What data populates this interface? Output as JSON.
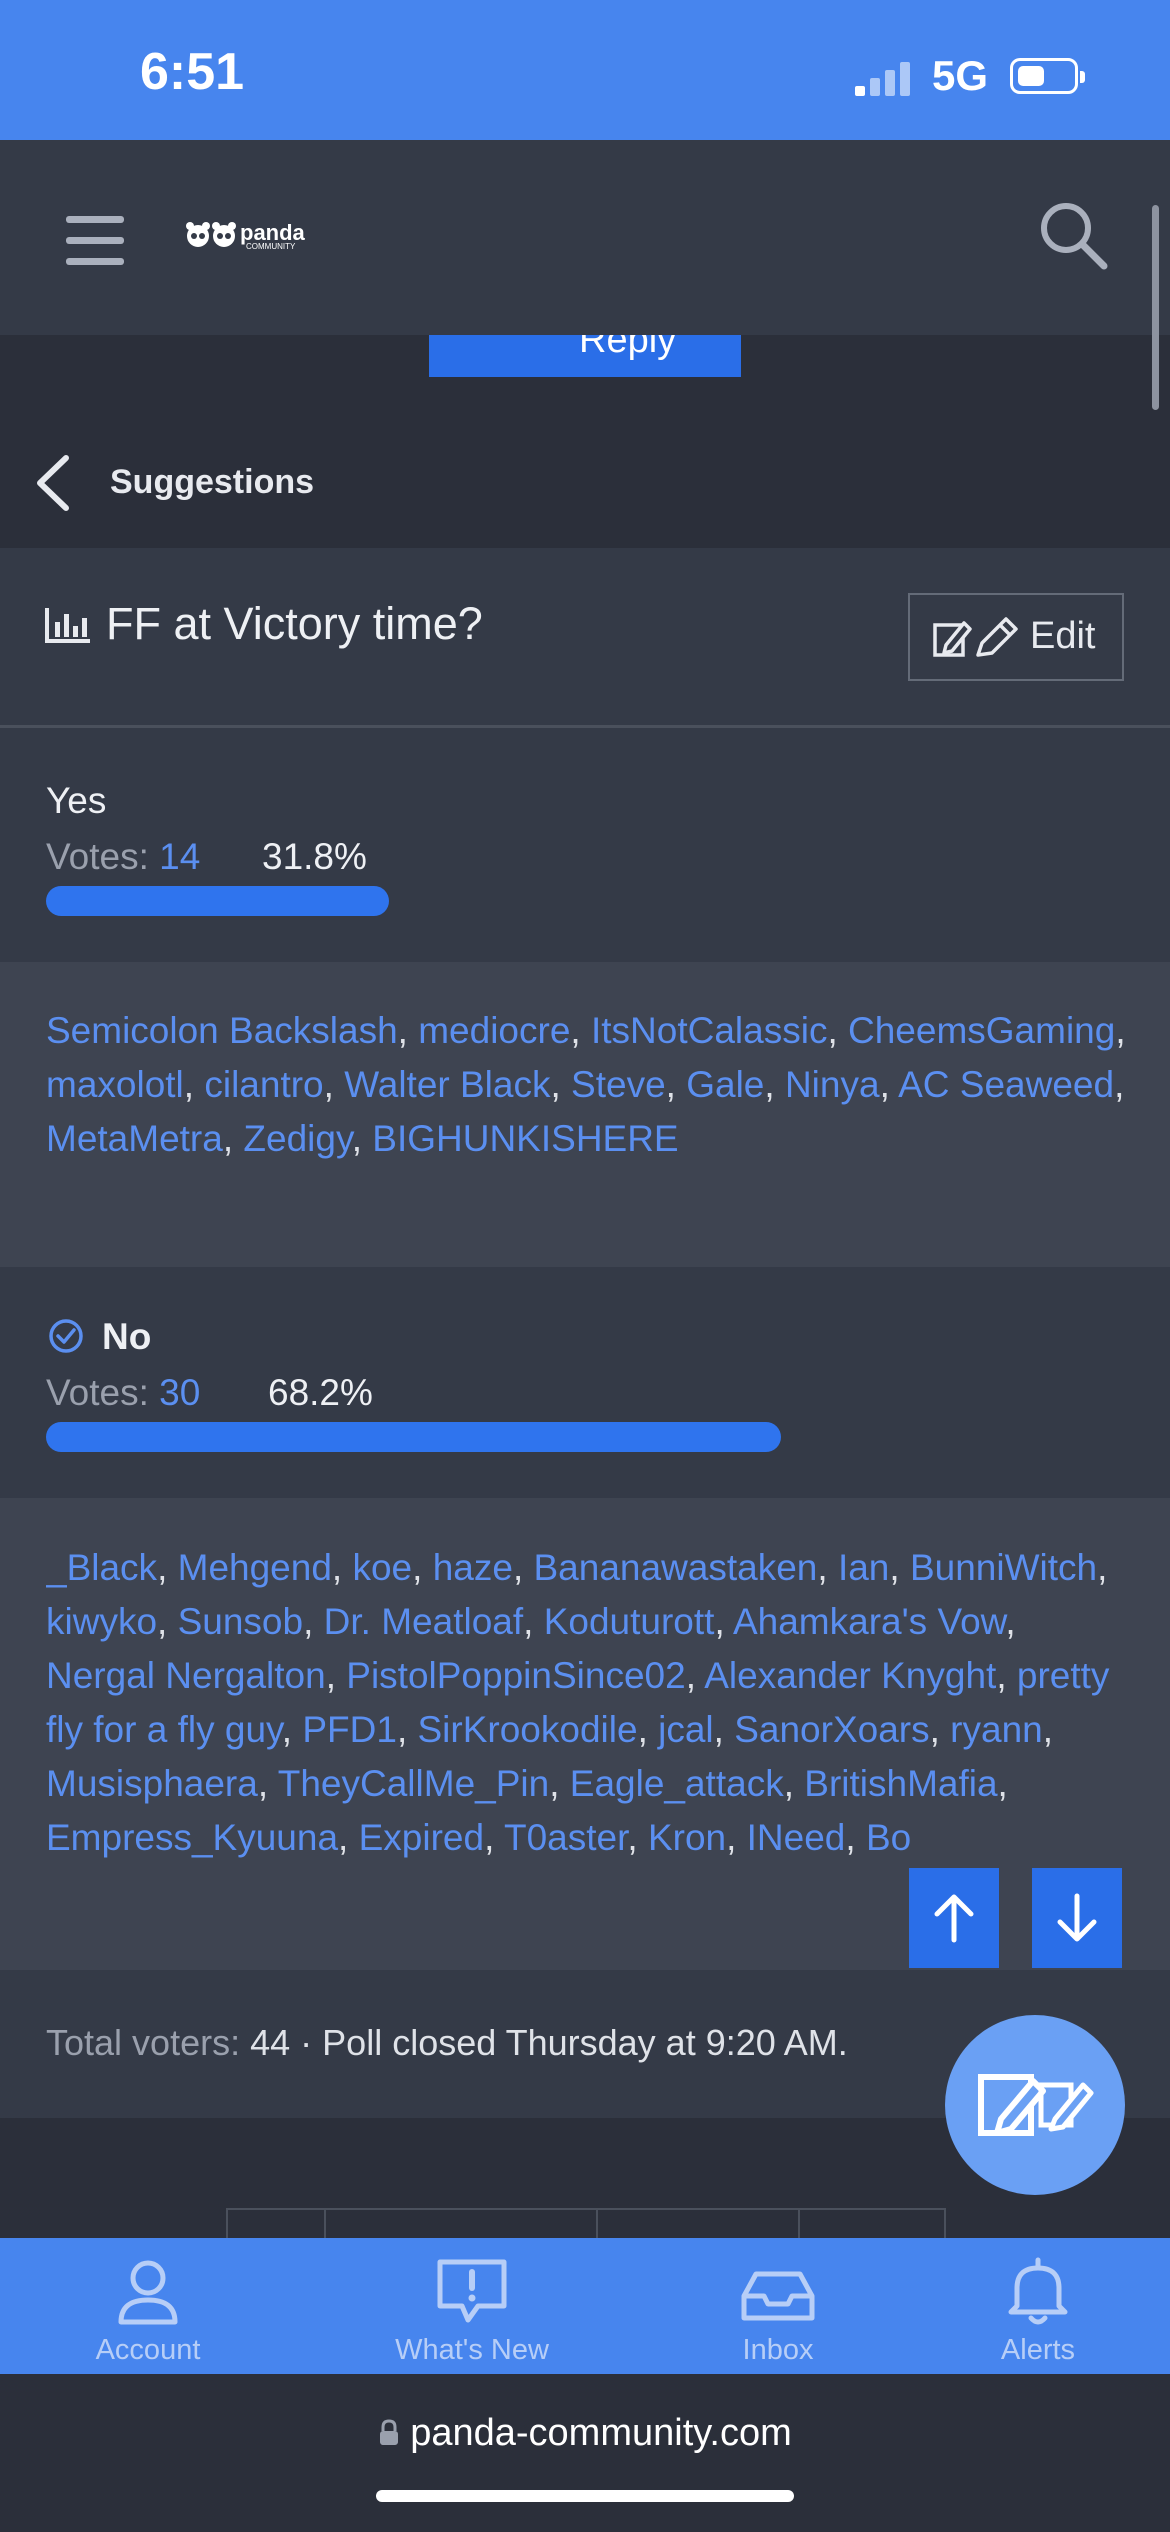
{
  "status_bar": {
    "time": "6:51",
    "network": "5G"
  },
  "header": {
    "logo_text": "panda",
    "logo_sub": "COMMUNITY"
  },
  "reply_button": {
    "label": "Reply"
  },
  "breadcrumb": {
    "label": "Suggestions"
  },
  "poll": {
    "title": "FF at Victory time?",
    "edit_label": "Edit",
    "votes_label": "Votes:",
    "responses": [
      {
        "label": "Yes",
        "votes": "14",
        "percent": "31.8%",
        "fraction": 0.318,
        "voters": [
          "Semicolon Backslash",
          "mediocre",
          "ItsNotCalassic",
          "CheemsGaming",
          "maxolotl",
          "cilantro",
          "Walter Black",
          "Steve",
          "Gale",
          "Ninya",
          "AC Seaweed",
          "MetaMetra",
          "Zedigy",
          "BIGHUNKISHERE"
        ]
      },
      {
        "label": "No",
        "votes": "30",
        "percent": "68.2%",
        "fraction": 0.682,
        "voted": true,
        "voters": [
          "_Black",
          "Mehgend",
          "koe",
          "haze",
          "Bananawastaken",
          "Ian",
          "BunniWitch",
          "kiwyko",
          "Sunsob",
          "Dr. Meatloaf",
          "Koduturott",
          "Ahamkara's Vow",
          "Nergal Nergalton",
          "PistolPoppinSince02",
          "Alexander Knyght",
          "pretty fly for a fly guy",
          "PFD1",
          "SirKrookodile",
          "jcal",
          "SanorXoars",
          "ryann",
          "Musisphaera",
          "TheyCallMe_Pin",
          "Eagle_attack",
          "BritishMafia",
          "Empress_Kyuuna",
          "Expired",
          "T0aster",
          "Kron",
          "INeed",
          "Bo"
        ]
      }
    ],
    "total_label": "Total voters:",
    "total_value": "44",
    "closed_text": "· Poll closed Thursday at 9:20 AM."
  },
  "tabs": [
    {
      "label": "Account",
      "icon": "user-icon"
    },
    {
      "label": "What's New",
      "icon": "alert-bubble-icon"
    },
    {
      "label": "Inbox",
      "icon": "inbox-icon"
    },
    {
      "label": "Alerts",
      "icon": "bell-icon"
    }
  ],
  "url_bar": {
    "url": "panda-community.com"
  },
  "colors": {
    "accent": "#4785ee",
    "link": "#5b8ff0",
    "bar": "#2f74ee",
    "panel": "#343a47",
    "background": "#2b2f3a"
  }
}
